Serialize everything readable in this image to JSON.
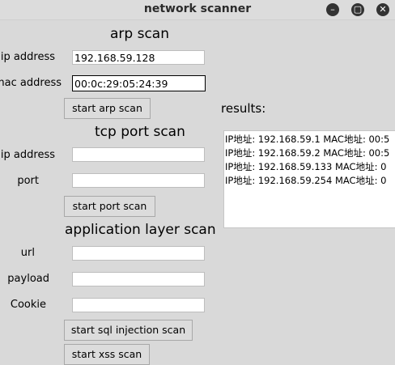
{
  "window": {
    "title": "network scanner",
    "minimize_glyph": "–",
    "maximize_glyph": "▢",
    "close_glyph": "✕"
  },
  "arp": {
    "heading": "arp scan",
    "ip_label": "ip address",
    "ip_value": "192.168.59.128",
    "mac_label": "mac address",
    "mac_value": "00:0c:29:05:24:39",
    "button": "start arp scan"
  },
  "tcp": {
    "heading": "tcp port scan",
    "ip_label": "ip address",
    "ip_value": "",
    "port_label": "port",
    "port_value": "",
    "button": "start port scan"
  },
  "app": {
    "heading": "application layer scan",
    "url_label": "url",
    "url_value": "",
    "payload_label": "payload",
    "payload_value": "",
    "cookie_label": "Cookie",
    "cookie_value": "",
    "sql_button": "start sql injection scan",
    "xss_button": "start xss scan"
  },
  "results": {
    "label": "results:",
    "rows": [
      "IP地址: 192.168.59.1 MAC地址: 00:5",
      "IP地址: 192.168.59.2 MAC地址: 00:5",
      "IP地址: 192.168.59.133 MAC地址: 0",
      "IP地址: 192.168.59.254 MAC地址: 0"
    ]
  }
}
